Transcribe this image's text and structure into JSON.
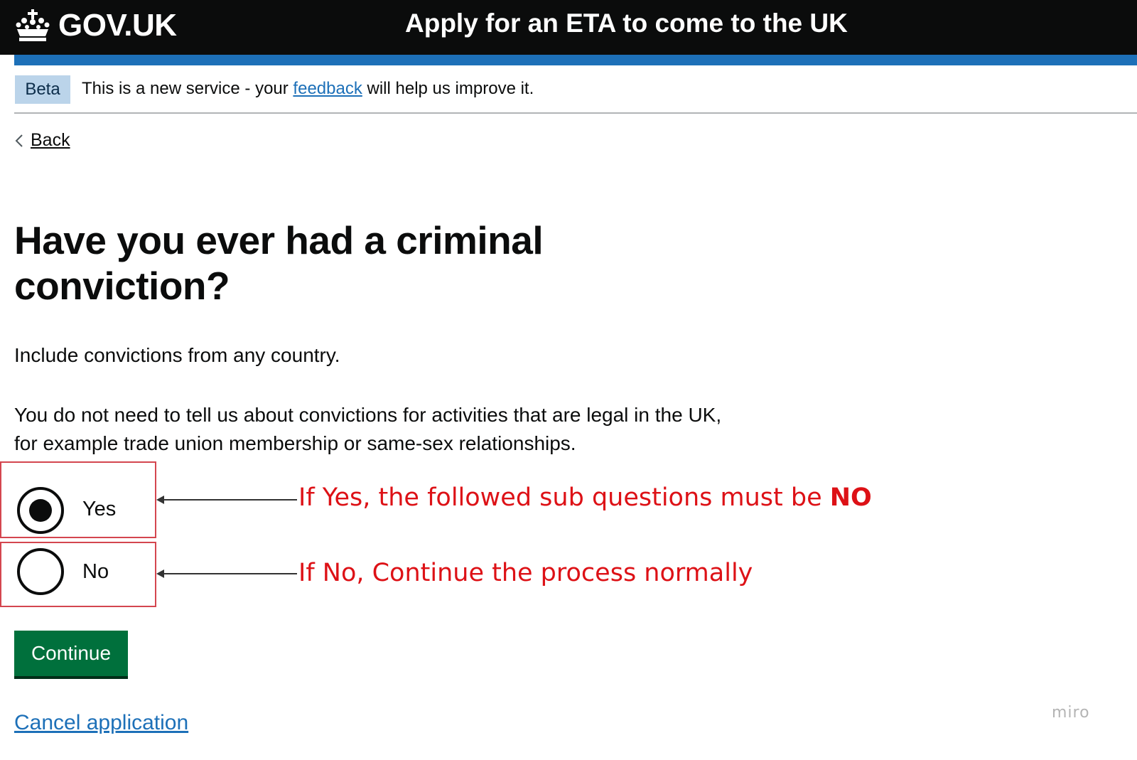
{
  "header": {
    "logo_text": "GOV.UK",
    "service_name": "Apply for an ETA to come to the UK",
    "logo_icon": "crown-icon"
  },
  "phase_banner": {
    "tag": "Beta",
    "text_before": "This is a new service - your ",
    "link_text": "feedback",
    "text_after": " will help us improve it."
  },
  "back": {
    "label": "Back",
    "icon": "chevron-left-icon"
  },
  "question": {
    "heading": "Have you ever had a criminal conviction?",
    "hint_1": "Include convictions from any country.",
    "hint_2": "You do not need to tell us about convictions for activities that are legal in the UK, for example trade union membership or same-sex relationships."
  },
  "options": [
    {
      "label": "Yes",
      "selected": true
    },
    {
      "label": "No",
      "selected": false
    }
  ],
  "annotations": {
    "yes_note_prefix": "If Yes, the followed sub questions must be ",
    "yes_note_bold": "NO",
    "no_note": "If No, Continue the process normally",
    "color": "#dd1116"
  },
  "continue_label": "Continue",
  "cancel_label": "Cancel application",
  "watermark": "miro",
  "colors": {
    "header_bg": "#0b0c0c",
    "brand_blue": "#1d70b8",
    "button_green": "#00703c",
    "highlight_border": "#d4464f"
  }
}
